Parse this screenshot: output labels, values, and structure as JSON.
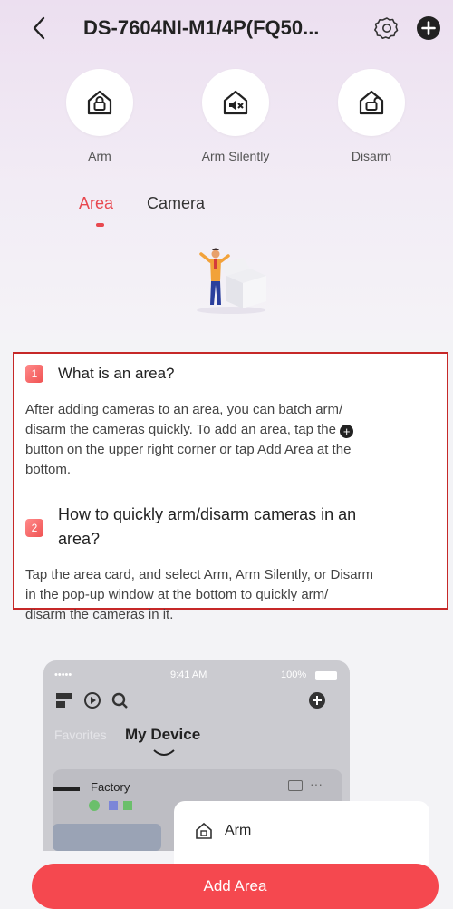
{
  "header": {
    "back_label": "<",
    "title": "DS-7604NI-M1/4P(FQ50..."
  },
  "modes": [
    {
      "label": "Arm",
      "icon": "lock-house-icon"
    },
    {
      "label": "Arm Silently",
      "icon": "muted-house-icon"
    },
    {
      "label": "Disarm",
      "icon": "unlock-house-icon"
    }
  ],
  "tabs": {
    "area": "Area",
    "camera": "Camera",
    "active": "Area"
  },
  "help": {
    "q1_number": "1",
    "q1_title": "What is an area?",
    "q1_body_a": "After adding cameras to an area, you can batch arm/",
    "q1_body_b": "disarm the cameras quickly. To add an area, tap the",
    "q1_body_c": "button on the upper right corner or tap Add Area at the",
    "q1_body_d": "bottom.",
    "q2_number": "2",
    "q2_title_a": "How to quickly arm/disarm cameras in an",
    "q2_title_b": "area?",
    "q2_body_a": "Tap the area card, and select Arm, Arm Silently, or Disarm",
    "q2_body_b": "in the pop-up window at the bottom to quickly arm/",
    "q2_body_c": "disarm the cameras in it."
  },
  "preview": {
    "status_signal": "•••••",
    "status_time": "9:41 AM",
    "status_battery": "100%",
    "tab_favorites": "Favorites",
    "tab_my_device": "My Device",
    "card_name": "Factory",
    "card_more": "···",
    "popup_arm": "Arm"
  },
  "footer": {
    "add_area_label": "Add Area"
  },
  "colors": {
    "accent": "#f5484f",
    "highlight_border": "#c62828"
  }
}
